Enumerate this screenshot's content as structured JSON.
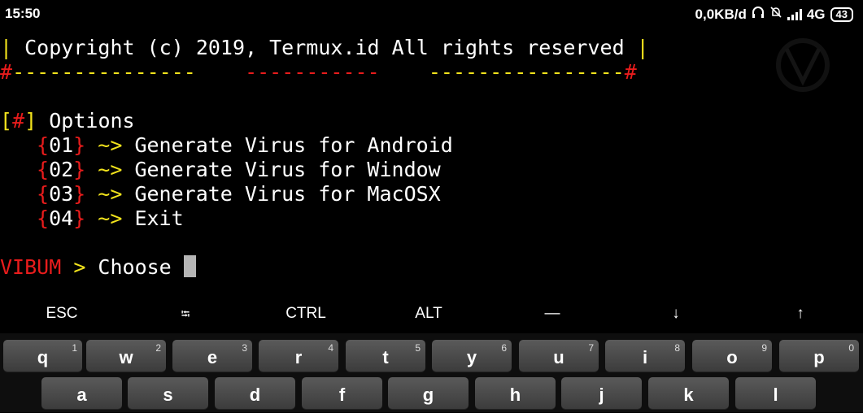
{
  "status": {
    "time": "15:50",
    "netspeed": "0,0KB/d",
    "network": "4G",
    "battery": "43"
  },
  "terminal": {
    "copyright_pre": "| ",
    "copyright_text": "Copyright (c) 2019, Termux.id All rights reserved",
    "copyright_post": " |",
    "sep_hash1": "#",
    "sep_dash1": "---------------",
    "sep_gap1": "    ",
    "sep_dash2": "-----------",
    "sep_gap2": "    ",
    "sep_dash3": "----------------",
    "sep_hash2": "#",
    "opt_bracket_open": "[",
    "opt_hash": "#",
    "opt_bracket_close": "]",
    "opt_label": " Options",
    "menu": [
      {
        "num": "01",
        "arrow": " ~> ",
        "text": "Generate Virus for Android"
      },
      {
        "num": "02",
        "arrow": " ~> ",
        "text": "Generate Virus for Window"
      },
      {
        "num": "03",
        "arrow": " ~> ",
        "text": "Generate Virus for MacOSX"
      },
      {
        "num": "04",
        "arrow": " ~> ",
        "text": "Exit"
      }
    ],
    "prompt_name": "VIBUM",
    "prompt_arrow": " > ",
    "prompt_text": "Choose "
  },
  "extra_keys": [
    "ESC",
    "⭾",
    "CTRL",
    "ALT",
    "—",
    "↓",
    "↑"
  ],
  "keyboard": {
    "row1": [
      {
        "key": "q",
        "hint": "1"
      },
      {
        "key": "w",
        "hint": "2"
      },
      {
        "key": "e",
        "hint": "3"
      },
      {
        "key": "r",
        "hint": "4"
      },
      {
        "key": "t",
        "hint": "5"
      },
      {
        "key": "y",
        "hint": "6"
      },
      {
        "key": "u",
        "hint": "7"
      },
      {
        "key": "i",
        "hint": "8"
      },
      {
        "key": "o",
        "hint": "9"
      },
      {
        "key": "p",
        "hint": "0"
      }
    ],
    "row2": [
      "a",
      "s",
      "d",
      "f",
      "g",
      "h",
      "j",
      "k",
      "l"
    ]
  },
  "colors": {
    "yellow": "#f2e31c",
    "red": "#e81c1c",
    "background": "#000000"
  }
}
